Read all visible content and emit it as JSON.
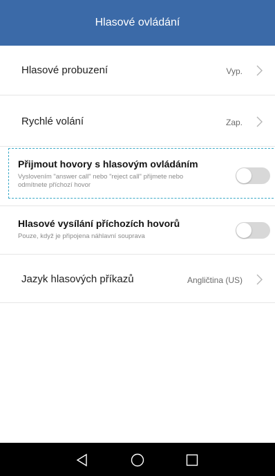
{
  "app_bar": {
    "title": "Hlasové ovládání"
  },
  "settings": [
    {
      "title": "Hlasové probuzení",
      "value": "Vyp."
    },
    {
      "title": "Rychlé volání",
      "value": "Zap."
    },
    {
      "title": "Přijmout hovory s hlasovým ovládáním",
      "subtitle": "Vyslovením \"answer call\" nebo \"reject call\" přijmete nebo odmítnete příchozí hovor",
      "toggle_on": false
    },
    {
      "title": "Hlasové vysílání příchozích hovorů",
      "subtitle": "Pouze, když je připojena náhlavní souprava",
      "toggle_on": false
    },
    {
      "title": "Jazyk hlasových příkazů",
      "value": "Angličtina (US)"
    }
  ],
  "colors": {
    "app_bar": "#3b6aa8",
    "highlight": "#3aa9c7",
    "toggle_off": "#d8d8d8",
    "nav_bar": "#000000"
  },
  "icons": {
    "chevron": "chevron-right-icon",
    "back": "back-triangle-icon",
    "home": "home-circle-icon",
    "recent": "recent-square-icon"
  }
}
